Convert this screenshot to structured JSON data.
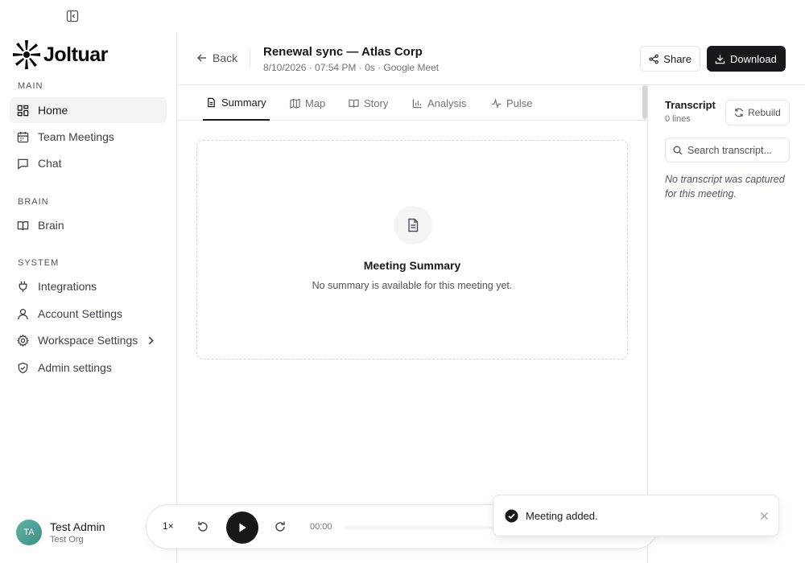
{
  "brand": {
    "name": "Joltuar"
  },
  "sidebar": {
    "sections": [
      {
        "label": "MAIN"
      },
      {
        "label": "BRAIN"
      },
      {
        "label": "SYSTEM"
      }
    ],
    "items": [
      {
        "label": "Home",
        "icon": "dashboard-icon",
        "active": true
      },
      {
        "label": "Team Meetings",
        "icon": "calendar-icon"
      },
      {
        "label": "Chat",
        "icon": "chat-icon"
      },
      {
        "label": "Brain",
        "icon": "book-icon"
      },
      {
        "label": "Integrations",
        "icon": "plug-icon"
      },
      {
        "label": "Account Settings",
        "icon": "user-icon"
      },
      {
        "label": "Workspace Settings",
        "icon": "gear-icon"
      },
      {
        "label": "Admin settings",
        "icon": "shield-icon"
      }
    ]
  },
  "user": {
    "initials": "TA",
    "name": "Test Admin",
    "org": "Test Org"
  },
  "header": {
    "back_label": "Back",
    "title": "Renewal sync — Atlas Corp",
    "meta": "8/10/2026 · 07:54 PM · 0s · Google Meet",
    "share_label": "Share",
    "download_label": "Download"
  },
  "tabs": [
    {
      "label": "Summary",
      "icon": "document-icon",
      "active": true
    },
    {
      "label": "Map",
      "icon": "map-icon"
    },
    {
      "label": "Story",
      "icon": "book-icon"
    },
    {
      "label": "Analysis",
      "icon": "bar-chart-icon"
    },
    {
      "label": "Pulse",
      "icon": "pulse-icon"
    }
  ],
  "summary": {
    "title": "Meeting Summary",
    "message": "No summary is available for this meeting yet."
  },
  "transcript": {
    "title": "Transcript",
    "count": "0 lines",
    "rebuild_label": "Rebuild",
    "search_placeholder": "Search transcript...",
    "empty_message": "No transcript was captured for this meeting."
  },
  "player": {
    "speed": "1×",
    "time": "00:00"
  },
  "toast": {
    "message": "Meeting added."
  },
  "colors": {
    "primary": "#18181b",
    "border": "#e4e4e7",
    "muted_text": "#71717a",
    "active_bg": "#f4f4f5",
    "avatar": "#4fa597"
  }
}
